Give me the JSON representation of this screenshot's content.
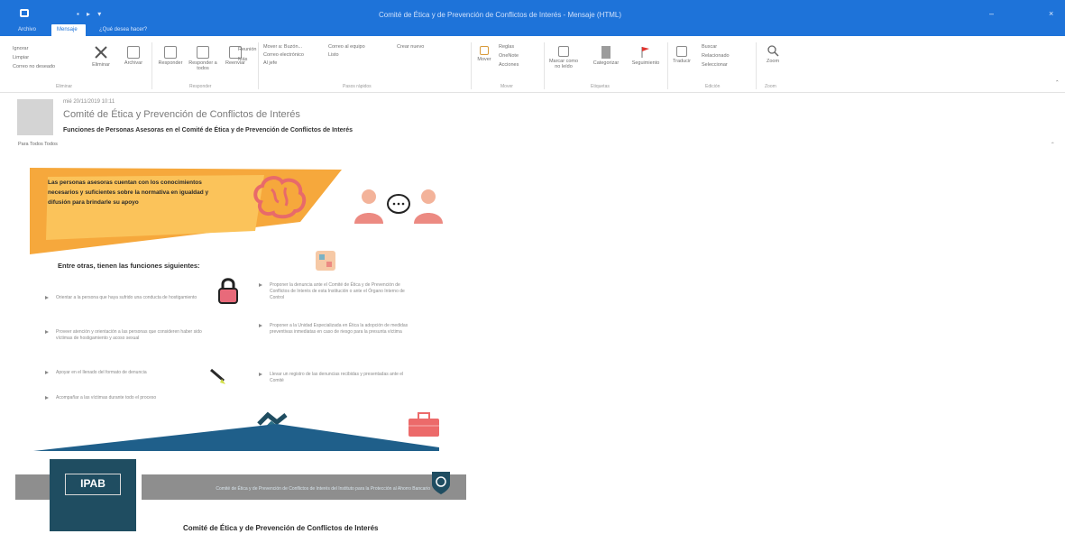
{
  "window": {
    "qat_glyphs": "▪ ▸ ▾",
    "title": "Comité de Ética y de Prevención de Conflictos de Interés - Mensaje (HTML)",
    "minimize_label": "–",
    "close_label": "×"
  },
  "tabs": [
    {
      "label": "Archivo"
    },
    {
      "label": "Mensaje"
    },
    {
      "label": "¿Qué desea hacer?"
    }
  ],
  "ribbon": {
    "delete_group": {
      "ignore": "Ignorar",
      "cleanup": "Limpiar",
      "junk": "Correo no deseado",
      "delete": "Eliminar",
      "archive": "Archivar",
      "label": "Eliminar"
    },
    "respond_group": {
      "reply": "Responder",
      "reply_all": "Responder a todos",
      "forward": "Reenviar",
      "meeting": "Reunión",
      "more": "Más",
      "label": "Responder"
    },
    "quicksteps_group": {
      "items": [
        "Mover a: Buzón...",
        "Correo electrónico",
        "Al jefe",
        "Correo al equipo",
        "Listo",
        "Crear nuevo"
      ],
      "label": "Pasos rápidos"
    },
    "move_group": {
      "move": "Mover",
      "rules": "Reglas",
      "onenote": "OneNote",
      "actions": "Acciones",
      "label": "Mover"
    },
    "tags_group": {
      "mark_unread": "Marcar como no leído",
      "categorize": "Categorizar",
      "followup": "Seguimiento",
      "label": "Etiquetas"
    },
    "editing_group": {
      "translate": "Traducir",
      "find": "Buscar",
      "related": "Relacionado",
      "select": "Seleccionar",
      "label": "Edición"
    },
    "zoom_group": {
      "zoom": "Zoom",
      "label": "Zoom"
    }
  },
  "message": {
    "date": "mié 20/11/2019 10:11",
    "from": "Comité de Ética y Prevención de Conflictos de Interés",
    "subject": "Funciones de Personas Asesoras en el Comité de Ética y de Prevención de Conflictos de Interés",
    "to": "Para  Todos  Todos"
  },
  "infographic": {
    "banner_text": "Las personas asesoras cuentan con los conocimientos necesarios y suficientes sobre la normativa en igualdad y difusión para brindarle su apoyo",
    "subtitle": "Entre otras, tienen las funciones siguientes:",
    "left_items": [
      "Orientar a la persona que haya sufrido una conducta de hostigamiento",
      "Proveer atención y orientación a las personas que consideren haber sido víctimas de hostigamiento y acoso sexual",
      "Apoyar en el llenado del formato de denuncia",
      "Acompañar a las víctimas durante todo el proceso"
    ],
    "right_items": [
      "Proponer la denuncia ante el Comité de Ética y de Prevención de Conflictos de Interés de esta Institución o ante el Órgano Interno de Control",
      "Proponer a la Unidad Especializada en Ética la adopción de medidas preventivas inmediatas en caso de riesgo para la presunta víctima",
      "Llevar un registro de las denuncias recibidas y presentadas ante el Comité"
    ],
    "logo_text": "IPAB",
    "band_text": "Comité de Ética y de Prevención de Conflictos de Interés del Instituto para la Protección al Ahorro Bancario",
    "footer_title": "Comité de Ética y de Prevención de Conflictos de Interés"
  },
  "colors": {
    "titlebar": "#1e73d9",
    "banner_orange": "#f6a83c",
    "banner_yellow": "#fbc35a",
    "dark_teal": "#1f4d61",
    "coral": "#ec7a6f"
  }
}
